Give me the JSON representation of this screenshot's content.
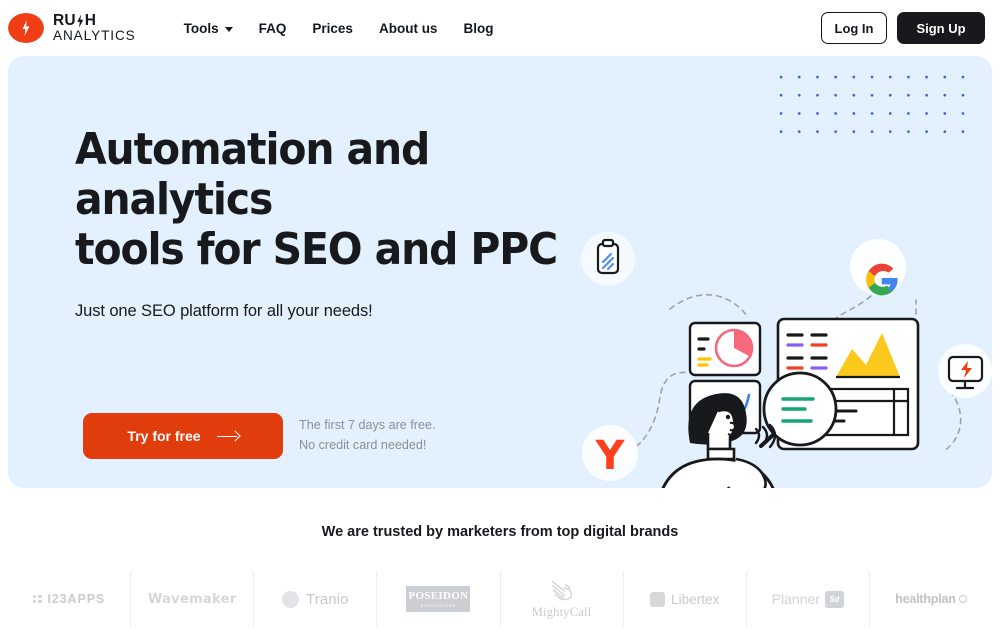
{
  "header": {
    "logo": {
      "line1": "RU",
      "line1b": "H",
      "line2": "ANALYTICS",
      "bolt_icon": "lightning-bolt-icon"
    },
    "nav": [
      {
        "label": "Tools",
        "has_dropdown": true
      },
      {
        "label": "FAQ",
        "has_dropdown": false
      },
      {
        "label": "Prices",
        "has_dropdown": false
      },
      {
        "label": "About us",
        "has_dropdown": false
      },
      {
        "label": "Blog",
        "has_dropdown": false
      }
    ],
    "login_label": "Log In",
    "signup_label": "Sign Up"
  },
  "hero": {
    "title": "Automation and analytics\ntools for SEO and PPC",
    "subtitle": "Just one SEO platform for all your needs!",
    "cta_label": "Try for free",
    "cta_arrow_icon": "arrow-right-icon",
    "cta_note": "The first 7 days are free.\nNo credit card needed!",
    "background_color": "#e2f1fd",
    "cta_color": "#e03c0c",
    "dot_color": "#3b5bdb",
    "badges": [
      {
        "name": "document-icon",
        "label": ""
      },
      {
        "name": "google-icon",
        "label": "G"
      },
      {
        "name": "yandex-icon",
        "label": "Y"
      },
      {
        "name": "monitor-bolt-icon",
        "label": ""
      }
    ]
  },
  "trusted": {
    "title": "We are trusted by marketers from top digital brands",
    "logos": [
      {
        "name": "123apps",
        "label": "I23APPS"
      },
      {
        "name": "wavemaker",
        "label": "Wavemaker"
      },
      {
        "name": "tranio",
        "label": "Tranio"
      },
      {
        "name": "poseidon",
        "label": "POSEIDON",
        "sub": "EXPEDITIONS"
      },
      {
        "name": "mightycall",
        "label": "MightyCall"
      },
      {
        "name": "libertex",
        "label": "Libertex"
      },
      {
        "name": "planner5d",
        "label": "Planner",
        "badge": "5d"
      },
      {
        "name": "healthplan",
        "label": "healthplan"
      }
    ]
  }
}
